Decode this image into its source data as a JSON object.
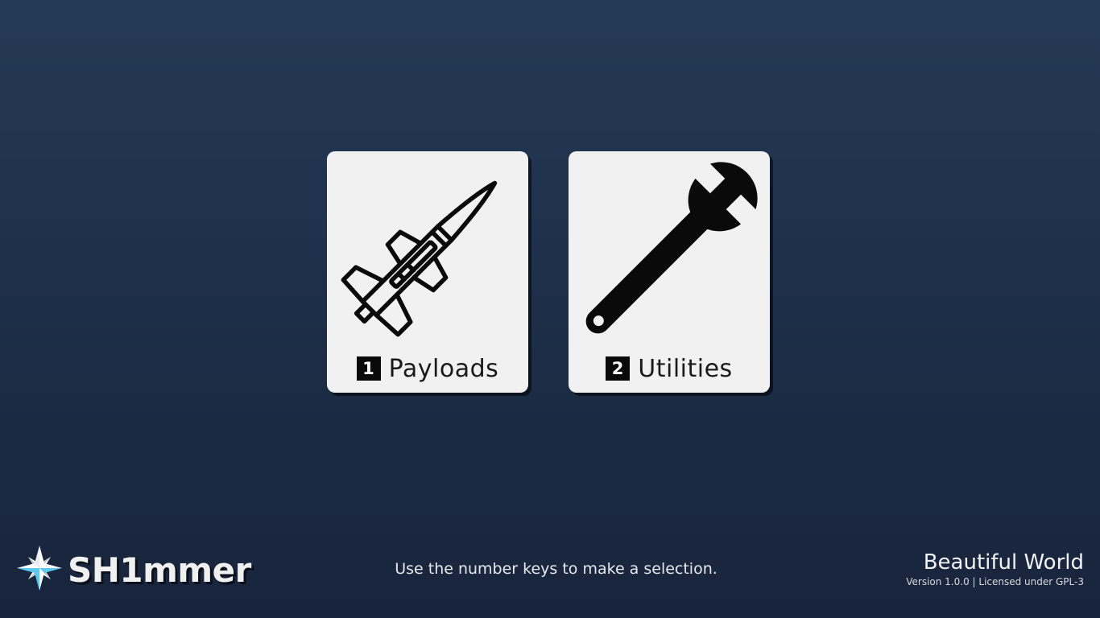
{
  "menu": {
    "items": [
      {
        "key": "1",
        "label": "Payloads",
        "icon": "missile-icon"
      },
      {
        "key": "2",
        "label": "Utilities",
        "icon": "wrench-icon"
      }
    ]
  },
  "footer": {
    "brand": "SH1mmer",
    "logo_icon": "compass-star-icon",
    "hint": "Use the number keys to make a selection.",
    "release_name": "Beautiful World",
    "version_line": "Version 1.0.0 | Licensed under GPL-3"
  },
  "colors": {
    "background_top": "#253a57",
    "background_bottom": "#18243b",
    "card": "#f1f1f1",
    "badge": "#0a0a0a",
    "logo_accent": "#5bc8ef"
  }
}
